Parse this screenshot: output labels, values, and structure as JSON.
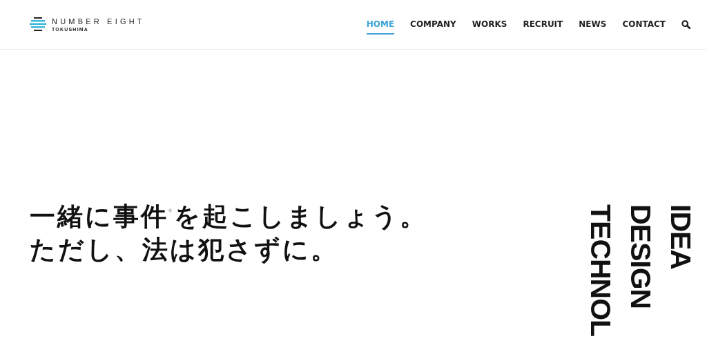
{
  "logo": {
    "name": "NUMBER EIGHT",
    "subtitle": "TOKUSHIMA"
  },
  "nav": [
    {
      "label": "HOME",
      "selected": true
    },
    {
      "label": "COMPANY",
      "selected": false
    },
    {
      "label": "WORKS",
      "selected": false
    },
    {
      "label": "RECRUIT",
      "selected": false
    },
    {
      "label": "NEWS",
      "selected": false
    },
    {
      "label": "CONTACT",
      "selected": false
    }
  ],
  "headline": [
    "一緒に事件$^{®}$を起こしましょう。",
    "ただし、法は犯さずに。"
  ],
  "vertical_words": [
    "IDEA",
    "DESIGN",
    "TECHNOL"
  ]
}
